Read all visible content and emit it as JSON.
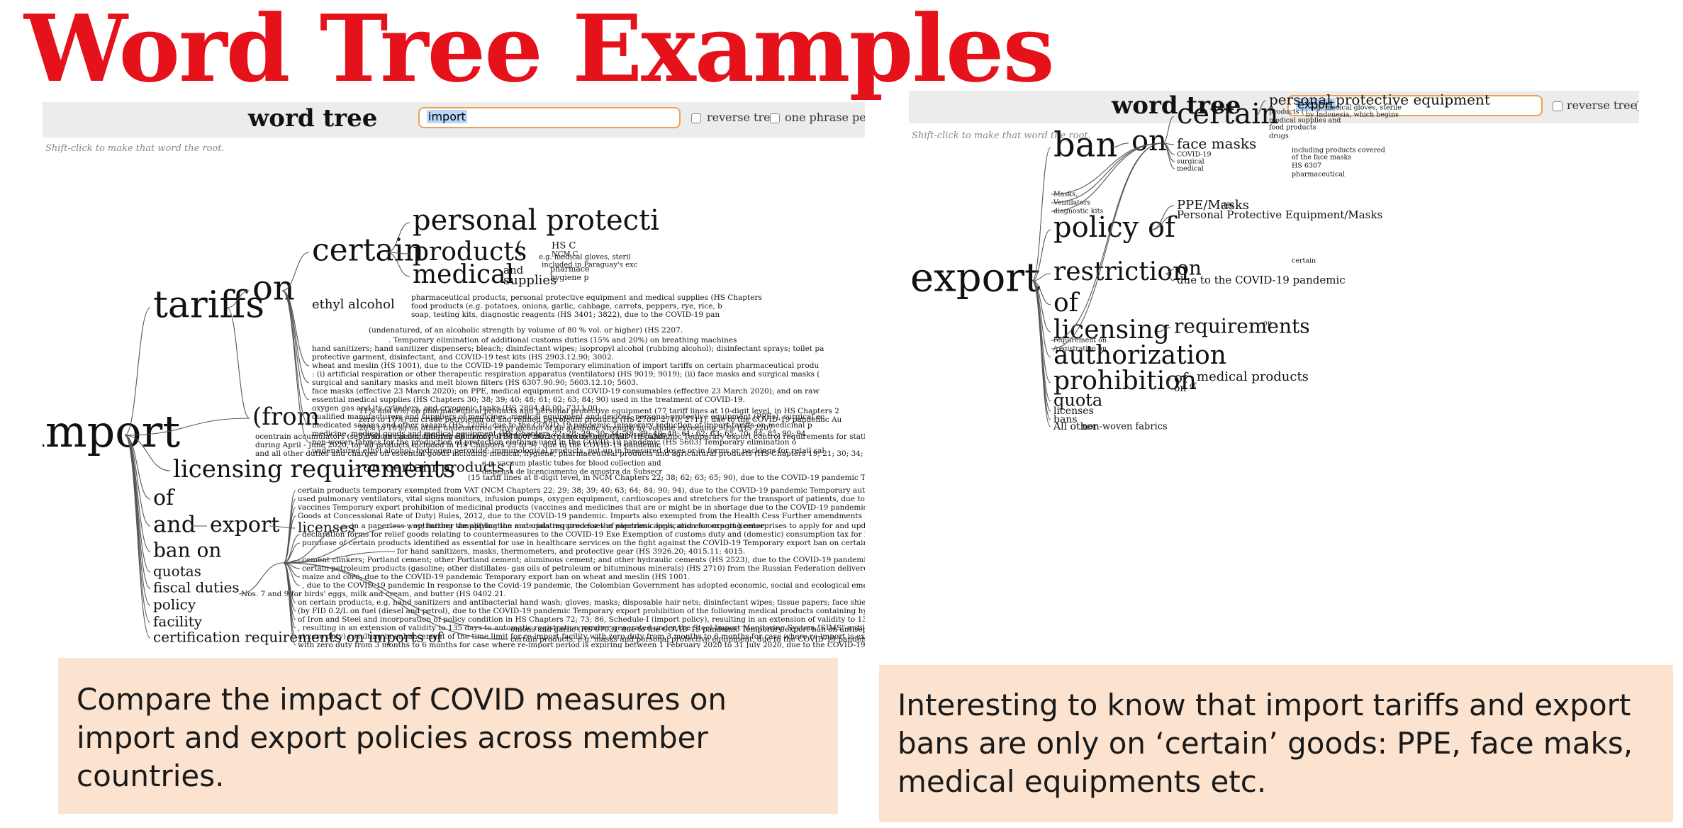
{
  "title": "Word Tree Examples",
  "left_panel": {
    "app_label": "word tree",
    "search_value": "import",
    "reverse_tree_label": "reverse tree",
    "one_phrase_label": "one phrase per l",
    "hint": "Shift-click to make that word the root.",
    "root": "import",
    "branches": [
      "tariffs",
      "on",
      "certain",
      "personal protecti",
      "products",
      "medical",
      "(from",
      "licensing requirements",
      "of",
      "and",
      "export",
      "ban on",
      "quotas",
      "fiscal duties",
      "policy",
      "facility",
      "certification requirements on imports of"
    ],
    "phrases": [
      "ethyl alcohol",
      "and",
      "supplies",
      "(",
      "HS C",
      "NCM C",
      "e.g. medical gloves, steril",
      "included in Paraguay's exc",
      "pharmace",
      "hygiene p",
      "on certain products (",
      "licenses",
      "e.g. vacuum plastic tubes for blood collection and",
      "dispensa de licenciamento de amostra da Subsecr",
      "pharmaceutical products, personal protective equipment and medical supplies (HS Chapters",
      "food products (e.g. potatoes, onions, garlic, cabbage, carrots, peppers, rye, rice, b",
      "soap, testing kits, diagnostic reagents (HS 3401; 3822), due to the COVID-19 pan",
      "(undenatured, of an alcoholic strength by volume of 80 % vol. or higher) (HS 2207.",
      ". Temporary elimination of additional customs duties (15% and 20%) on breathing machines",
      "hand sanitizers; hand sanitizer dispensers; bleach; disinfectant wipes; isopropyl alcohol (rubbing alcohol); disinfectant sprays; toilet pa",
      "protective garment, disinfectant, and COVID-19 test kits (HS 2903.12.90; 3002.",
      "wheat and meslin (HS 1001), due to the COVID-19 pandemic Temporary elimination of import tariffs on certain pharmaceutical produ",
      ": (i) artificial respiration or other therapeutic respiration apparatus (ventilators) (HS 9019; 9019); (ii) face masks and surgical masks (",
      "surgical and sanitary masks and melt blown filters (HS 6307.90.90; 5603.12.10; 5603.",
      "face masks (effective 23 March 2020); on PPE, medical equipment and COVID-19 consumables (effective 23 March 2020); and on raw",
      "essential medical supplies (HS Chapters 30; 38; 39; 40; 48; 61; 62; 63; 84; 90) used in the treatment of COVID-19.",
      "oxygen gas and its cylinders, and cryogenic tanks (HS 2804.40.00; 7311.00.",
      "qualified manufacturers and suppliers of medicines, medical equipment and devices, personal protective equipment (PPEs), surgical ec",
      "medicated saaans and other saaans (HS 2208), due to the COVID-19 pandemic Temporary reduction of import tariffs on medicinal p",
      "medicine, medical goods and medical equipment (HS Chapters 22; 28; 29; 30; 34; 38; 39; 40; 48; 61; 62; 63; 65; 70; 84; 85; 90; 94",
      "non-woven fabrics for the production of protection clothing used in the COVID-19 pandemic (HS 5603) Temporary elimination o",
      "undenatured ethyl alcohol; hydrogen peroxide; immunological products, put up in measured doses or in forms or packings for retail sal",
      "11% and 6%) on pharmaceutical products and personal protective equipment (77 tariff lines at 10-digit level, in HS Chapters 2",
      "zero to 10%) on crude petroleum oil and refined petroleum products (HS 2709; 2710; 2711), due to the COVID-19 pandemic Au",
      "20% to 10%) on other undenatured ethyl alcohol of an alcoholic strength by volume exceeding 90% (HS 2207.",
      "7.5%) on masks, filtering efficiency of 94% or more, of textile materials (HS 6307.",
      "ocentrain accumulators (separadores acumuladores eléctricos) (HS 8507.90.20), due to the COVID-19 pandemic Temporary export control requirements for statistic",
      "during April - June 2020, for all products included in HS Chapters 25 to 97, due to the COVID-19 pandemic",
      "and all other duties and charges on essential goods including medical, hygiene, pharmaceutical products and agricultural products (HS Chapters 19; 21; 30; 34; 38; 39",
      "(15 tariff lines at 8-digit level, in NCM Chapters 22; 38; 62; 63; 65; 90), due to the COVID-19 pandemic Tem",
      "certain products temporary exempted from VAT (NCM Chapters 22; 29; 38; 39; 40; 63; 64; 84; 90; 94), due to the COVID-19 pandemic Temporary authorization to accept exceptionally document",
      "used pulmonary ventilators, vital signs monitors, infusion pumps, oxygen equipment, cardioscopes and stretchers for the transport of patients, due to the COVID-19 pandemic Temporary simplification",
      "vaccines Temporary export prohibition of medicinal products (vaccines and medicines that are or might be in shortage due to the COVID-19 pandemic) Temporary ban on certain leg",
      "Goods at Concessional Rate of Duty) Rules, 2012, due to the COVID-19 pandemic. Imports also exempted from the Health Cess Further amendments introduced to the export policy of formulation",
      "; optimizing the application and updating processes of electronic keys, and encouraging enterprises to apply for and upd",
      "declaration forms for relief goods relating to countermeasures to the COVID-19 Exe Exemption of customs duty and (domestic) consumption tax for imp",
      "purchase of certain products identified as essential for use in healthcare services on the fight against the COVID-19 Temporary export ban on certain quinine-based drugs, due to the COVI",
      "for hand sanitizers, masks, thermometers, and protective gear (HS 3926.20; 4015.11; 4015.",
      "cement clinkers; Portland cement; other Portland cement; aluminous cement; and other hydraulic cements (HS 2523), due to the COVID-19 pandemic Temporary ban on cer",
      "certain petroleum products (gasoline; other distillates- gas oils of petroleum or bituminous minerals) (HS 2710) from the Russian Federation delivered by railway, due to the COVID-19",
      "maize and corn, due to the COVID-19 pandemic Temporary export ban on wheat and meslin (HS 1001.",
      ", due to the COVID-19 pandemic In response to the Covid-19 pandemic, the Colombian Government has adopted economic, social and ecological emergency measures to prevent and address",
      "Nos. 7 and 9 for birds' eggs, milk and cream, and butter (HS 0402.21.",
      "on certain products, e.g. hand sanitizers and antibacterial hand wash; gloves; masks; disposable hair nets; disinfectant wipes; tissue papers; face shields (medical use); medical goggl",
      "(by FID 0.2/L on fuel (diesel and petrol), due to the COVID-19 pandemic Temporary export prohibition of the following medical products containing hydroxychlor",
      "of Iron and Steel and incorporation of policy condition in HS Chapters 72; 73; 86, Schedule-I (import policy), resulting in an extension of validity to 135 days to automatic registration number g",
      ", resulting in an extension of validity to 135 days to automatic registration number generated under the Steel Import Monitoring System \"SIMS\" until 31 March 2020, due to the COVID-19 pan",
      "at zero duty) resulting in enhancement of the time limit for re-import facility with zero duty from 3 months to 6 months for case where re-import is expiring between 1 February 2020",
      "with zero duty from 3 months to 6 months for case where re-import period is expiring between 1 February 2020 to 31 July 2020, due to the COVID-19 pandemic Further amendments introdu",
      "onions and garlic (HS 0703), due to the COVID-19 pandemic Temporary export ban on antiseptic, raw materials to fabrica",
      "certain products, e.g. masks and personal protective equipment, due to the COVID-19 pandemic Postponing the payment o",
      "in a paperless way; further simplifying the materials required for the paperless application for export license"
    ]
  },
  "right_panel": {
    "app_label": "word tree",
    "search_value": "export",
    "reverse_tree_label": "reverse tree",
    "hint": "Shift-click to make that word the root.",
    "root": "export",
    "branches": [
      "ban",
      "on",
      "certain",
      "personal protective equipment",
      "face masks",
      "policy of",
      "PPE/Masks",
      "Personal Protective Equipment/Masks",
      "restriction",
      "on",
      "due to the COVID-19 pandemic",
      "of",
      "licensing",
      "requirements",
      "authorization",
      "prohibition",
      "medical products",
      "of",
      "on",
      "quota",
      "licenses",
      "bans",
      "All other",
      "non-woven fabrics"
    ],
    "phrases": [
      "products (",
      "medical supplies and",
      "food products",
      "drugs",
      "COVID-19",
      "surgical",
      "medical",
      "Masks,",
      "Ventilators",
      "diagnostic kits",
      "certain",
      "on",
      "of",
      "requirement on",
      "/registration on",
      "(HS",
      ", e.g. medical gloves, sterile",
      "by Indonesia, which begins",
      "including products covered",
      "of the face masks",
      "HS 6307",
      "pharmaceutical"
    ]
  },
  "notes": {
    "left": "Compare the impact of COVID measures on import and export policies across member countries.",
    "right": "Interesting to know that import tariffs and export bans are only on ‘certain’ goods: PPE, face maks, medical equipments etc."
  },
  "colors": {
    "title": "#e5111b",
    "search_border": "#f0a050",
    "search_highlight": "#b9d6f7",
    "toolbar_bg": "#ececec",
    "note_bg": "#fbe3cf"
  }
}
